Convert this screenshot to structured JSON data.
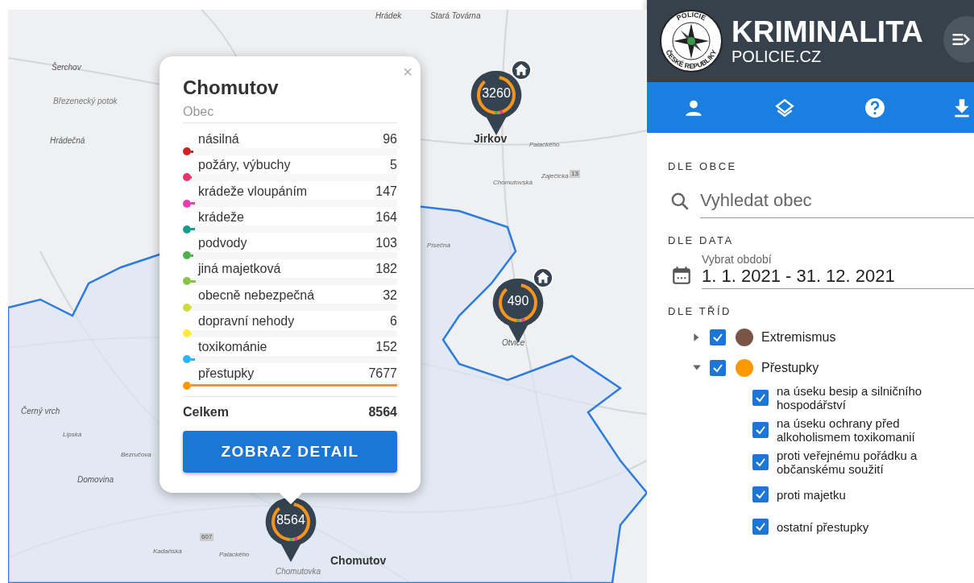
{
  "map": {
    "labels": [
      {
        "text": "Hrádek",
        "kind": "minor"
      },
      {
        "text": "Stará Továrna",
        "kind": "minor"
      },
      {
        "text": "Šerchov",
        "kind": "minor"
      },
      {
        "text": "Březenecký potok",
        "kind": "water"
      },
      {
        "text": "Hrádečná",
        "kind": "minor"
      },
      {
        "text": "Jirkov",
        "kind": "town"
      },
      {
        "text": "Palackého",
        "kind": "street"
      },
      {
        "text": "Zaječická",
        "kind": "street"
      },
      {
        "text": "13",
        "kind": "road"
      },
      {
        "text": "Chomutovská",
        "kind": "street"
      },
      {
        "text": "Písečná",
        "kind": "street"
      },
      {
        "text": "Otvice",
        "kind": "minor"
      },
      {
        "text": "Černý vrch",
        "kind": "minor"
      },
      {
        "text": "Lipská",
        "kind": "street"
      },
      {
        "text": "Domovina",
        "kind": "minor"
      },
      {
        "text": "Bezručova",
        "kind": "street"
      },
      {
        "text": "Kadaňská",
        "kind": "street"
      },
      {
        "text": "607",
        "kind": "road"
      },
      {
        "text": "Palackého",
        "kind": "street"
      },
      {
        "text": "Chomutov",
        "kind": "town"
      },
      {
        "text": "Chomutovka",
        "kind": "water"
      }
    ],
    "markers": [
      {
        "count": "3260",
        "home": true
      },
      {
        "count": "490",
        "home": true
      },
      {
        "count": "8564",
        "home": false
      }
    ]
  },
  "popup": {
    "title": "Chomutov",
    "subtitle": "Obec",
    "rows": [
      {
        "label": "násilná",
        "value": "96",
        "color": "#d32027",
        "level": 0.013
      },
      {
        "label": "požáry, výbuchy",
        "value": "5",
        "color": "#e8336d",
        "level": 0.001
      },
      {
        "label": "krádeže vloupáním",
        "value": "147",
        "color": "#e040b0",
        "level": 0.019
      },
      {
        "label": "krádeže",
        "value": "164",
        "color": "#1a9a8a",
        "level": 0.021
      },
      {
        "label": "podvody",
        "value": "103",
        "color": "#4caf50",
        "level": 0.013
      },
      {
        "label": "jiná majetková",
        "value": "182",
        "color": "#8bc34a",
        "level": 0.024
      },
      {
        "label": "obecně nebezpečná",
        "value": "32",
        "color": "#cddc39",
        "level": 0.004
      },
      {
        "label": "dopravní nehody",
        "value": "6",
        "color": "#ffeb3b",
        "level": 0.001
      },
      {
        "label": "toxikománie",
        "value": "152",
        "color": "#29b6f6",
        "level": 0.02
      },
      {
        "label": "přestupky",
        "value": "7677",
        "color": "#ff9800",
        "level": 1
      }
    ],
    "total_label": "Celkem",
    "total_value": "8564",
    "button": "ZOBRAZ DETAIL",
    "close": "×"
  },
  "sidebar": {
    "brand": "KRIMINALITA",
    "site": "POLICIE.CZ",
    "badge_top": "POLICIE",
    "badge_bottom": "ČESKÉ REPUBLIKY",
    "sections": {
      "municipality": "DLE OBCE",
      "date": "DLE DATA",
      "classes": "DLE TŘÍD"
    },
    "search": {
      "placeholder": "Vyhledat obec"
    },
    "date": {
      "label": "Vybrat období",
      "value": "1. 1. 2021 - 31. 12. 2021"
    },
    "tree": [
      {
        "label": "Extremismus",
        "checked": true,
        "expanded": false,
        "color": "#795548"
      },
      {
        "label": "Přestupky",
        "checked": true,
        "expanded": true,
        "color": "#ff9800",
        "children": [
          {
            "label": "na úseku besip a silničního hospodářství",
            "checked": true
          },
          {
            "label": "na úseku ochrany před alkoholismem toxikomanií",
            "checked": true
          },
          {
            "label": "proti veřejnému pořádku a občanskému soužití",
            "checked": true
          },
          {
            "label": "proti majetku",
            "checked": true
          },
          {
            "label": "ostatní přestupky",
            "checked": true
          }
        ]
      }
    ]
  }
}
